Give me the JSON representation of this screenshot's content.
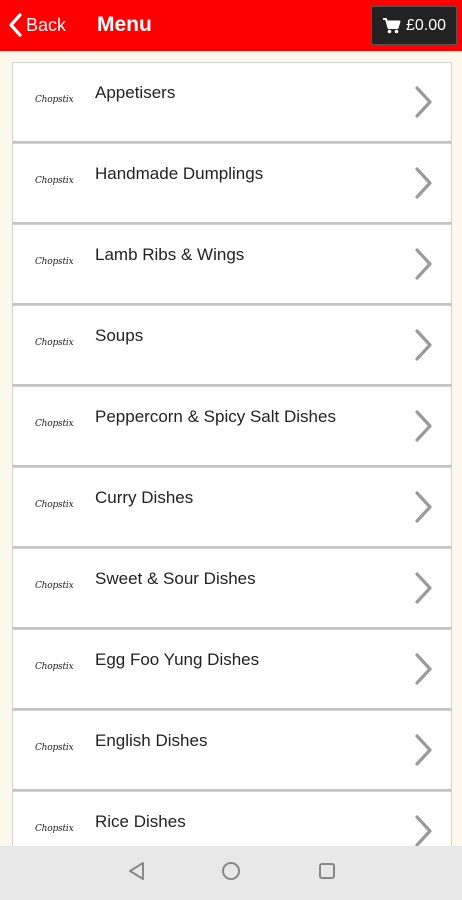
{
  "header": {
    "back_label": "Back",
    "title": "Menu",
    "cart_total": "£0.00",
    "background_color": "#ff0000"
  },
  "menu": {
    "logo_text": "Chopstix",
    "items": [
      {
        "label": "Appetisers"
      },
      {
        "label": "Handmade Dumplings"
      },
      {
        "label": "Lamb Ribs & Wings"
      },
      {
        "label": "Soups"
      },
      {
        "label": "Peppercorn & Spicy Salt Dishes"
      },
      {
        "label": "Curry Dishes"
      },
      {
        "label": "Sweet & Sour Dishes"
      },
      {
        "label": "Egg Foo Yung Dishes"
      },
      {
        "label": "English Dishes"
      },
      {
        "label": "Rice Dishes"
      }
    ]
  },
  "icons": {
    "back": "chevron-left-icon",
    "cart": "shopping-cart-icon",
    "item_arrow": "chevron-right-icon",
    "nav_back": "triangle-back-icon",
    "nav_home": "circle-home-icon",
    "nav_recents": "square-recents-icon"
  }
}
